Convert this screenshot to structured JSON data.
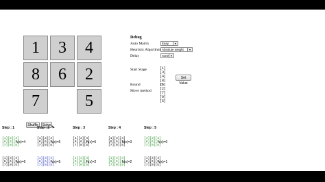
{
  "board": {
    "tiles": [
      {
        "label": "1",
        "row": 0,
        "col": 0
      },
      {
        "label": "3",
        "row": 0,
        "col": 1
      },
      {
        "label": "4",
        "row": 0,
        "col": 2
      },
      {
        "label": "8",
        "row": 1,
        "col": 0
      },
      {
        "label": "6",
        "row": 1,
        "col": 1
      },
      {
        "label": "2",
        "row": 1,
        "col": 2
      },
      {
        "label": "7",
        "row": 2,
        "col": 0
      },
      {
        "label": "",
        "row": 2,
        "col": 1
      },
      {
        "label": "5",
        "row": 2,
        "col": 2
      }
    ]
  },
  "controls": {
    "shuffle_label": "Shuffle",
    "solve_label": "Solve"
  },
  "debug": {
    "title": "Debug",
    "auto_matrix_label": "Auto Matrix",
    "auto_matrix_value": "Easy",
    "heuristic_label": "Heuristic Algorithm",
    "heuristic_value": "Absolute weight",
    "delay_label": "Delay",
    "delay_value": "none",
    "start_stage_label": "Start Stage",
    "start_stage_lines": [
      "[1][3][4]",
      "[8][6][2]",
      "[7][0][5]"
    ],
    "set_value_label": "Set Value",
    "round_label": "Round",
    "round_value": "0",
    "move_method_label": "Move method"
  },
  "steps": [
    {
      "title": "Step : 1",
      "candidates": [
        {
          "grid": [
            "[1][3][4]",
            "[8][6][2]",
            "[7][0][5]"
          ],
          "h": "h(x)=4"
        },
        {
          "grid": [
            "[1][3][4]",
            "[8][6][2]",
            "[7][0][5]"
          ],
          "h": "h(x)=6"
        }
      ]
    },
    {
      "title": "Step : 2",
      "candidates": [
        {
          "grid": [
            "[1][3][4]",
            "[8][6][2]",
            "[7][0][5]"
          ],
          "h": "h(x)=5"
        },
        {
          "grid": [
            "[1][3][4]",
            "[8][6][2]",
            "[7][0][5]"
          ],
          "h": "h(x)=5"
        }
      ]
    },
    {
      "title": "Step : 3",
      "candidates": [
        {
          "grid": [
            "[1][3][4]",
            "[8][6][2]",
            "[7][0][5]"
          ],
          "h": "h(x)=6"
        },
        {
          "grid": [
            "[1][3][4]",
            "[8][6][2]",
            "[7][0][5]"
          ],
          "h": "h(x)=2"
        }
      ]
    },
    {
      "title": "Step : 4",
      "candidates": [
        {
          "grid": [
            "[1][3][4]",
            "[8][6][2]",
            "[7][0][5]"
          ],
          "h": "h(x)=3"
        },
        {
          "grid": [
            "[1][3][4]",
            "[8][6][2]",
            "[7][0][5]"
          ],
          "h": "h(x)=2"
        }
      ]
    },
    {
      "title": "Step : 5",
      "candidates": [
        {
          "grid": [
            "[1][3][4]",
            "[8][6][2]",
            "[7][0][5]"
          ],
          "h": "h(x)=0"
        },
        {
          "grid": [
            "[1][3][4]",
            "[8][6][2]",
            "[7][0][5]"
          ],
          "h": "h(x)=1"
        }
      ]
    }
  ]
}
